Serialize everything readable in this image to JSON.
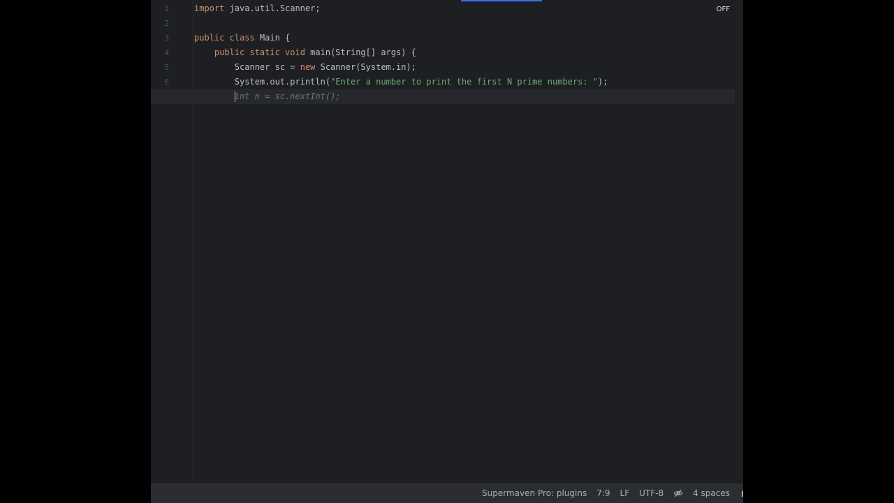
{
  "editor": {
    "inspection_toggle": "OFF",
    "current_line": 7,
    "lines": [
      {
        "num": "1",
        "tokens": [
          {
            "t": "import",
            "c": "kw"
          },
          {
            "t": " java.util.Scanner;",
            "c": ""
          }
        ]
      },
      {
        "num": "2",
        "tokens": []
      },
      {
        "num": "3",
        "tokens": [
          {
            "t": "public class",
            "c": "kw"
          },
          {
            "t": " Main {",
            "c": ""
          }
        ]
      },
      {
        "num": "4",
        "tokens": [
          {
            "t": "    ",
            "c": ""
          },
          {
            "t": "public static void",
            "c": "kw"
          },
          {
            "t": " main(String[] args) {",
            "c": ""
          }
        ]
      },
      {
        "num": "5",
        "tokens": [
          {
            "t": "        Scanner sc = ",
            "c": ""
          },
          {
            "t": "new",
            "c": "kw"
          },
          {
            "t": " Scanner(System.in);",
            "c": ""
          }
        ]
      },
      {
        "num": "6",
        "tokens": [
          {
            "t": "        System.out.println(",
            "c": ""
          },
          {
            "t": "\"Enter a number to print the first N prime numbers: \"",
            "c": "str"
          },
          {
            "t": ");",
            "c": ""
          }
        ]
      },
      {
        "num": "7",
        "tokens": [
          {
            "t": "        ",
            "c": ""
          },
          {
            "t": "|",
            "c": "caret"
          },
          {
            "t": "int n = sc.nextInt();",
            "c": "ghost"
          }
        ]
      }
    ]
  },
  "status_bar": {
    "plugin": "Supermaven Pro: plugins",
    "position": "7:9",
    "line_ending": "LF",
    "encoding": "UTF-8",
    "readonly_icon": "eye-off-icon",
    "indent": "4 spaces"
  }
}
